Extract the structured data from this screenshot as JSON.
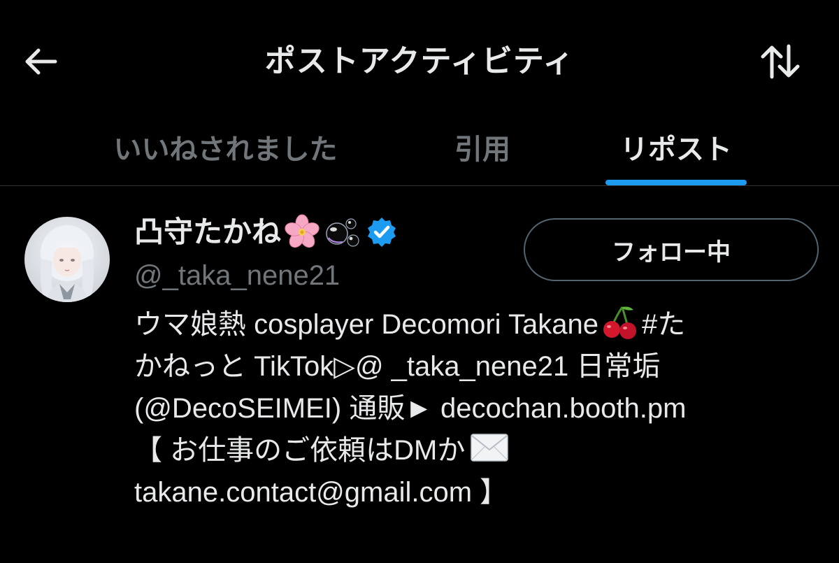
{
  "header": {
    "title": "ポストアクティビティ",
    "back_icon": "arrow-left-icon",
    "sort_icon": "sort-arrows-icon"
  },
  "tabs": [
    {
      "label": "いいねされました",
      "active": false
    },
    {
      "label": "引用",
      "active": false
    },
    {
      "label": "リポスト",
      "active": true
    }
  ],
  "user": {
    "display_name": "凸守たかね",
    "name_emojis": [
      "cherry-blossom-emoji",
      "bubbles-emoji"
    ],
    "verified": true,
    "handle": "@_taka_nene21",
    "follow_label": "フォロー中",
    "bio": {
      "line1": "ウマ娘熱 cosplayer Decomori Takane",
      "line1_tail": "#た",
      "line2": "かねっと TikTok▷@ _taka_nene21 日常垢",
      "line3": "(@DecoSEIMEI) 通販► decochan.booth.pm",
      "line4": "【 お仕事のご依頼はDMか",
      "line5": "takane.contact@gmail.com 】"
    }
  },
  "colors": {
    "background": "#000000",
    "text_primary": "#e7e9ea",
    "text_secondary": "#71767b",
    "accent": "#1d9bf0",
    "divider": "#2f3336"
  }
}
